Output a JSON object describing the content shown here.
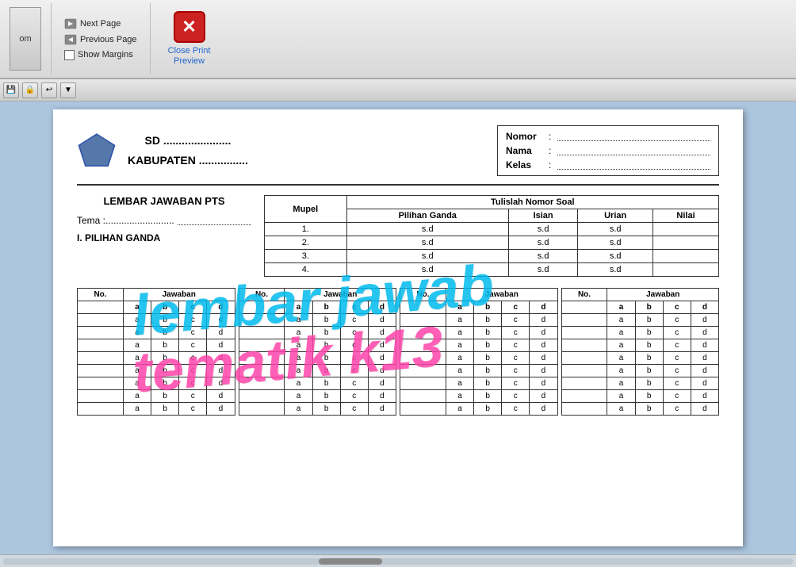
{
  "toolbar": {
    "next_page_label": "Next Page",
    "prev_page_label": "Previous Page",
    "show_margins_label": "Show Margins",
    "close_print_label": "Close Print Preview",
    "preview_group_label": "Preview",
    "zoom_label": "om"
  },
  "document": {
    "school_name_line1": "SD ......................",
    "school_name_line2": "KABUPATEN ................",
    "info": {
      "nomor_label": "Nomor",
      "nama_label": "Nama",
      "kelas_label": "Kelas",
      "colon": ":"
    },
    "form_title": "LEMBAR JAWABAN PTS",
    "tema_label": "Tema :..........................",
    "pilihan_ganda_title": "I.  PILIHAN GANDA",
    "soal_table": {
      "mupel_header": "Mupel",
      "tulislah_header": "Tulislah Nomor Soal",
      "pilihan_ganda_header": "Pilihan Ganda",
      "isian_header": "Isian",
      "urian_header": "Urian",
      "nilai_header": "Nilai",
      "rows": [
        {
          "num": "1.",
          "pg": "s.d",
          "isian": "s.d",
          "urian": "s.d",
          "nilai": ""
        },
        {
          "num": "2.",
          "pg": "s.d",
          "isian": "s.d",
          "urian": "s.d",
          "nilai": ""
        },
        {
          "num": "3.",
          "pg": "s.d",
          "isian": "s.d",
          "urian": "s.d",
          "nilai": ""
        },
        {
          "num": "4.",
          "pg": "s.d",
          "isian": "s.d",
          "urian": "s.d",
          "nilai": ""
        }
      ]
    },
    "answer_columns": [
      {
        "header": "No.",
        "subheaders": [
          "a",
          "b",
          "c",
          "d"
        ],
        "rows": 8
      }
    ],
    "watermark1": "lembar jawab",
    "watermark2": "tematik k13"
  }
}
